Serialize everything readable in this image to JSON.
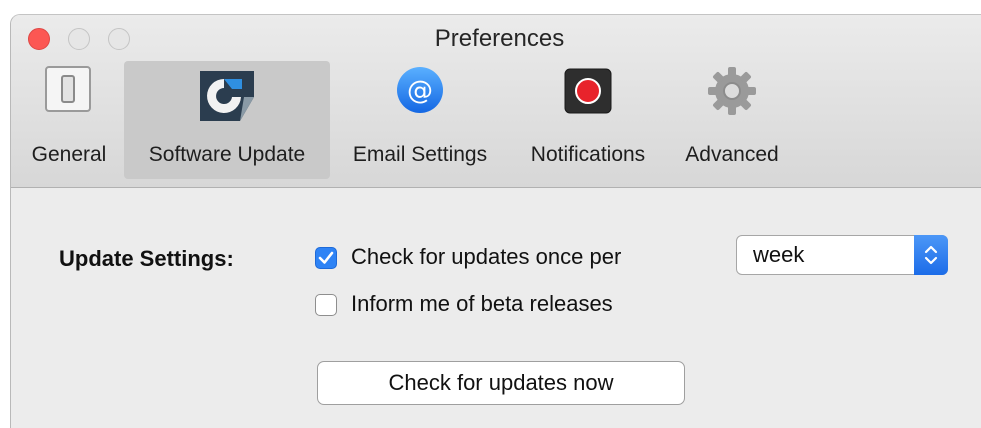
{
  "window": {
    "title": "Preferences"
  },
  "tabs": [
    {
      "label": "General",
      "icon": "switch-icon"
    },
    {
      "label": "Software Update",
      "icon": "software-update-icon"
    },
    {
      "label": "Email Settings",
      "icon": "at-sign-icon"
    },
    {
      "label": "Notifications",
      "icon": "record-icon"
    },
    {
      "label": "Advanced",
      "icon": "gear-icon"
    }
  ],
  "selected_tab": "Software Update",
  "update_settings": {
    "label": "Update Settings:",
    "check_updates": {
      "label": "Check for updates once per",
      "checked": true
    },
    "frequency": {
      "value": "week"
    },
    "beta": {
      "label": "Inform me of beta releases",
      "checked": false
    },
    "check_now_label": "Check for updates now"
  },
  "colors": {
    "accent": "#2e83f5",
    "close": "#fc5753"
  }
}
